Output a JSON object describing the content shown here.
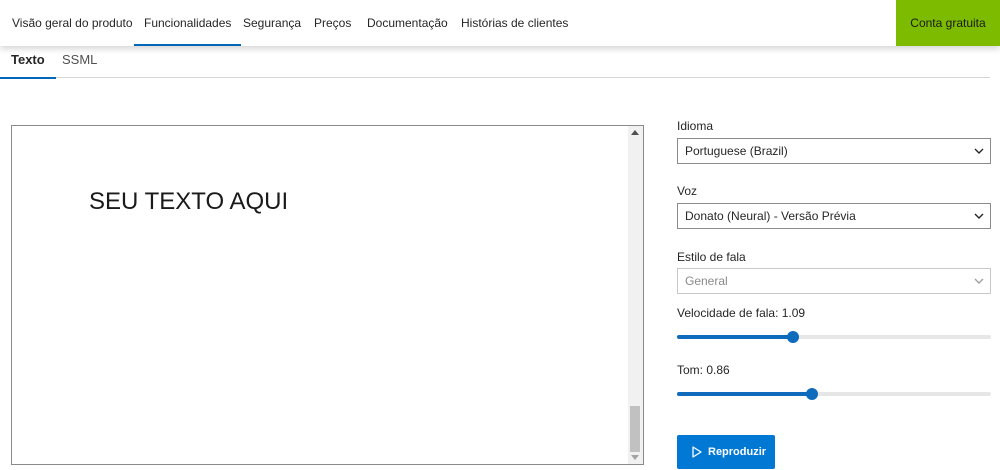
{
  "nav": {
    "items": [
      {
        "label": "Visão geral do produto"
      },
      {
        "label": "Funcionalidades"
      },
      {
        "label": "Segurança"
      },
      {
        "label": "Preços"
      },
      {
        "label": "Documentação"
      },
      {
        "label": "Histórias de clientes"
      }
    ],
    "active_index": 1,
    "cta_label": "Conta gratuita"
  },
  "tabs": [
    {
      "label": "Texto",
      "active": true
    },
    {
      "label": "SSML",
      "active": false
    }
  ],
  "editor": {
    "text": "SEU TEXTO AQUI"
  },
  "settings": {
    "language": {
      "label": "Idioma",
      "value": "Portuguese (Brazil)"
    },
    "voice": {
      "label": "Voz",
      "value": "Donato (Neural) - Versão Prévia"
    },
    "style": {
      "label": "Estilo de fala",
      "value": "General",
      "disabled": true
    },
    "rate": {
      "label": "Velocidade de fala: 1.09",
      "value": 1.09,
      "fraction": 0.37
    },
    "pitch": {
      "label": "Tom: 0.86",
      "value": 0.86,
      "fraction": 0.43
    },
    "play_label": "Reproduzir"
  },
  "colors": {
    "accent": "#0078d4",
    "cta": "#7cbb00",
    "active_underline": "#0067b8"
  },
  "icons": {
    "play": "play-icon",
    "dropdown": "chevron-down-icon"
  }
}
